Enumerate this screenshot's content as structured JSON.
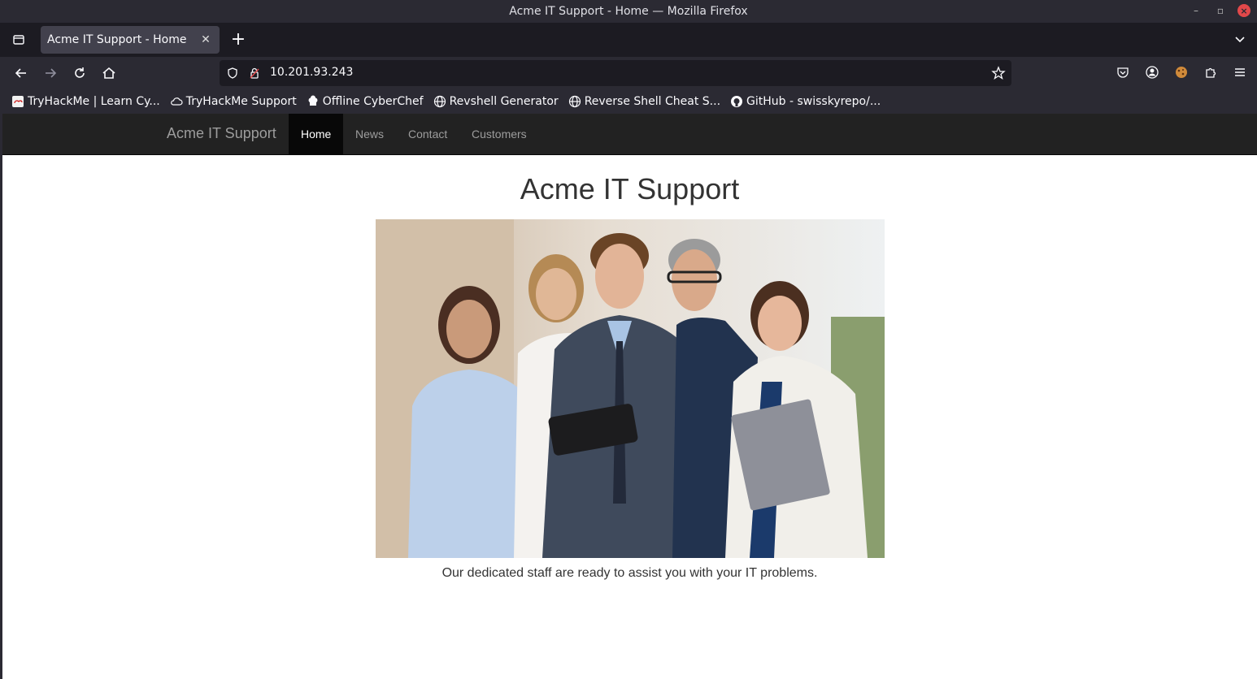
{
  "window": {
    "title": "Acme IT Support - Home — Mozilla Firefox"
  },
  "tabs": [
    {
      "label": "Acme IT Support - Home"
    }
  ],
  "urlbar": {
    "url": "10.201.93.243"
  },
  "bookmarks": [
    {
      "label": "TryHackMe | Learn Cy...",
      "icon": "tryhackme-icon"
    },
    {
      "label": "TryHackMe Support",
      "icon": "cloud-icon"
    },
    {
      "label": "Offline CyberChef",
      "icon": "chef-hat-icon"
    },
    {
      "label": "Revshell Generator",
      "icon": "globe-icon"
    },
    {
      "label": "Reverse Shell Cheat S...",
      "icon": "globe-icon"
    },
    {
      "label": "GitHub - swisskyrepo/...",
      "icon": "github-icon"
    }
  ],
  "site": {
    "brand": "Acme IT Support",
    "nav": [
      {
        "label": "Home",
        "active": true
      },
      {
        "label": "News"
      },
      {
        "label": "Contact"
      },
      {
        "label": "Customers"
      }
    ],
    "heading": "Acme IT Support",
    "image_alt": "team-photo",
    "caption": "Our dedicated staff are ready to assist you with your IT problems."
  },
  "colors": {
    "site_nav_bg": "#222222",
    "site_nav_active": "#080808",
    "browser_bg": "#2b2a33",
    "close_red": "#e2484a"
  }
}
